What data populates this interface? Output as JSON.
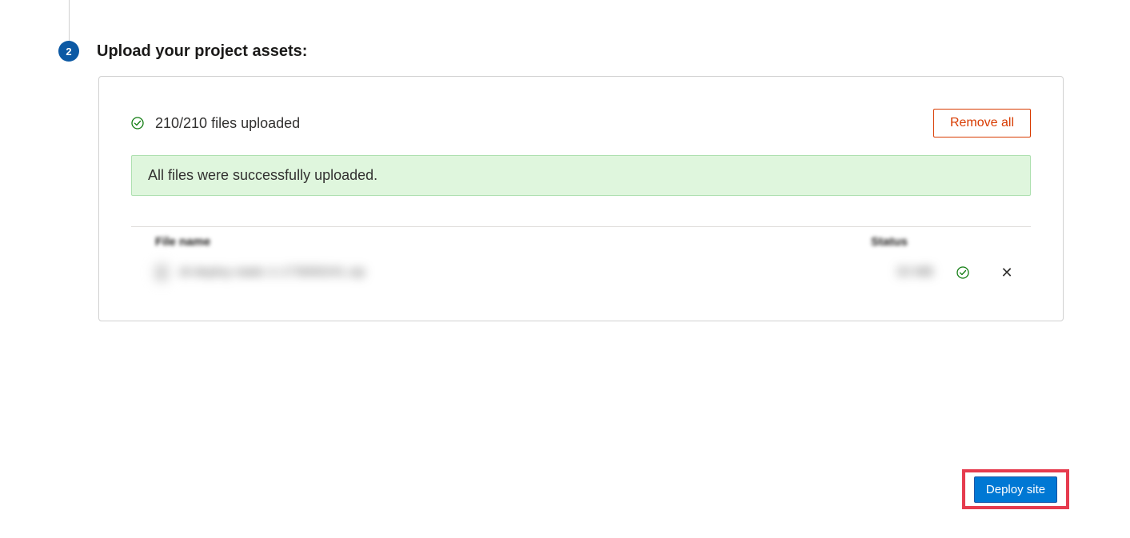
{
  "step": {
    "number": "2",
    "title": "Upload your project assets:"
  },
  "upload": {
    "count_text": "210/210 files uploaded",
    "remove_all_label": "Remove all",
    "success_message": "All files were successfully uploaded."
  },
  "table": {
    "header_filename": "File name",
    "header_status": "Status"
  },
  "file_row": {
    "name": "di-deploy-static-1-173000241.zip",
    "size": "33 MB"
  },
  "actions": {
    "deploy_label": "Deploy site"
  },
  "colors": {
    "step_badge": "#0c59a4",
    "danger": "#d83b01",
    "success_bg": "#dff6dd",
    "primary": "#0078d4",
    "highlight_border": "#e63b4e",
    "check_green": "#107c10"
  }
}
